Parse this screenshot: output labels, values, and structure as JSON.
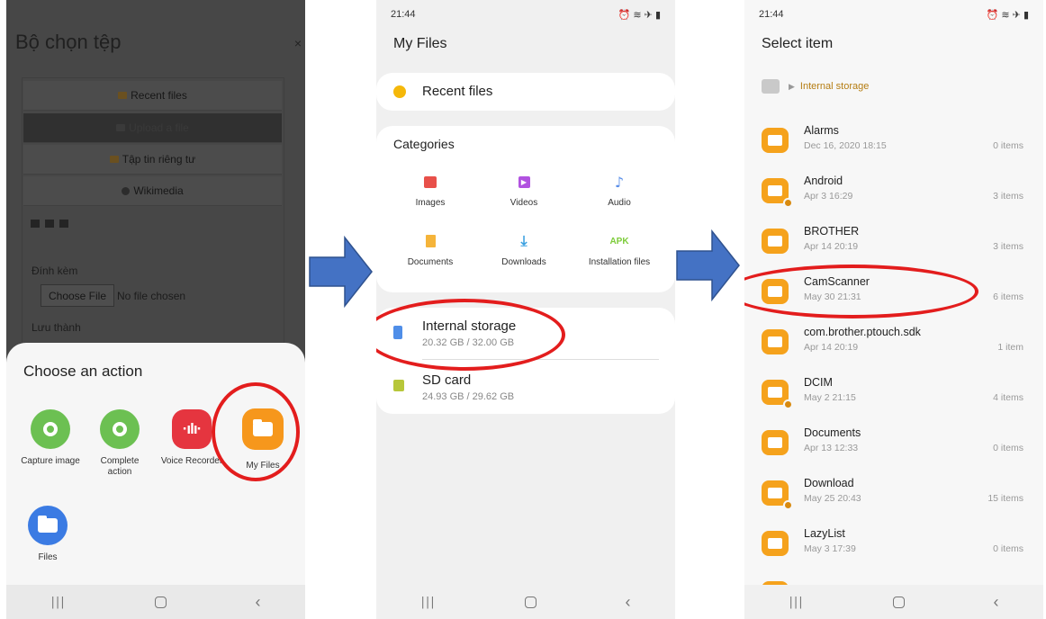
{
  "phone1": {
    "title": "Bộ chọn tệp",
    "close": "×",
    "repos": [
      "Recent files",
      "Upload a file",
      "Tập tin riêng tư",
      "Wikimedia"
    ],
    "attach_label": "Đính kèm",
    "choose_file_button": "Choose File",
    "no_file_text": "No file chosen",
    "save_as_label": "Lưu thành",
    "sheet_title": "Choose an action",
    "apps": [
      {
        "label": "Capture image",
        "icon": "camera-gear-icon"
      },
      {
        "label": "Complete action",
        "icon": "camera-gear-icon"
      },
      {
        "label": "Voice Recorder",
        "icon": "waveform-icon"
      },
      {
        "label": "My Files",
        "icon": "folder-icon"
      },
      {
        "label": "Files",
        "icon": "folder-icon"
      }
    ]
  },
  "phone2": {
    "time": "21:44",
    "status_icons": "⏰ ≋ ✈ ▮",
    "title": "My Files",
    "recent_files": "Recent files",
    "categories_title": "Categories",
    "categories": [
      {
        "label": "Images",
        "icon": "image-icon"
      },
      {
        "label": "Videos",
        "icon": "video-icon"
      },
      {
        "label": "Audio",
        "icon": "music-note-icon"
      },
      {
        "label": "Documents",
        "icon": "document-icon"
      },
      {
        "label": "Downloads",
        "icon": "download-icon"
      },
      {
        "label": "Installation files",
        "icon": "apk-icon",
        "icon_text": "APK"
      }
    ],
    "storage": [
      {
        "name": "Internal storage",
        "usage": "20.32 GB / 32.00 GB"
      },
      {
        "name": "SD card",
        "usage": "24.93 GB / 29.62 GB"
      }
    ]
  },
  "phone3": {
    "time": "21:44",
    "status_icons": "⏰ ≋ ✈ ▮",
    "title": "Select item",
    "breadcrumb": "Internal storage",
    "folders": [
      {
        "name": "Alarms",
        "date": "Dec 16, 2020 18:15",
        "count": "0 items"
      },
      {
        "name": "Android",
        "date": "Apr 3 16:29",
        "count": "3 items"
      },
      {
        "name": "BROTHER",
        "date": "Apr 14 20:19",
        "count": "3 items"
      },
      {
        "name": "CamScanner",
        "date": "May 30 21:31",
        "count": "6 items"
      },
      {
        "name": "com.brother.ptouch.sdk",
        "date": "Apr 14 20:19",
        "count": "1 item"
      },
      {
        "name": "DCIM",
        "date": "May 2 21:15",
        "count": "4 items"
      },
      {
        "name": "Documents",
        "date": "Apr 13 12:33",
        "count": "0 items"
      },
      {
        "name": "Download",
        "date": "May 25 20:43",
        "count": "15 items"
      },
      {
        "name": "LazyList",
        "date": "May 3 17:39",
        "count": "0 items"
      }
    ]
  },
  "navbar": {
    "recents": "|||",
    "home": "",
    "back": "‹"
  },
  "colors": {
    "highlight_ring": "#e31d1d",
    "arrow_fill": "#4472c4",
    "folder_orange": "#f5a21c",
    "breadcrumb_text": "#b57d12"
  }
}
